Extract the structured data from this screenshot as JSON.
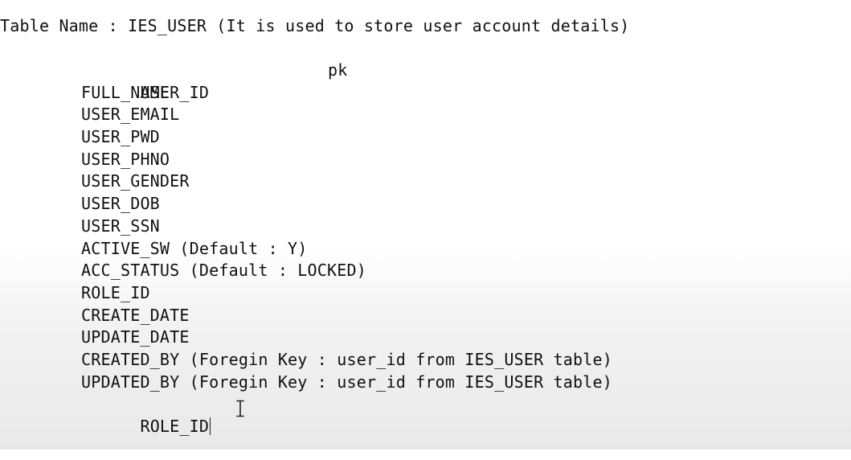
{
  "title_line": "Table Name : IES_USER (It is used to store user account details)",
  "primary_key_tag": "pk",
  "fields": [
    "USER_ID",
    "FULL_NAME",
    "USER_EMAIL",
    "USER_PWD",
    "USER_PHNO",
    "USER_GENDER",
    "USER_DOB",
    "USER_SSN",
    "ACTIVE_SW (Default : Y)",
    "ACC_STATUS (Default : LOCKED)",
    "ROLE_ID",
    "CREATE_DATE",
    "UPDATE_DATE",
    "CREATED_BY (Foregin Key : user_id from IES_USER table)",
    "UPDATED_BY (Foregin Key : user_id from IES_USER table)",
    "ROLE_ID"
  ],
  "icons": {
    "text_cursor": "i-beam-cursor-icon"
  },
  "colors": {
    "text": "#111111",
    "background": "#ffffff"
  }
}
